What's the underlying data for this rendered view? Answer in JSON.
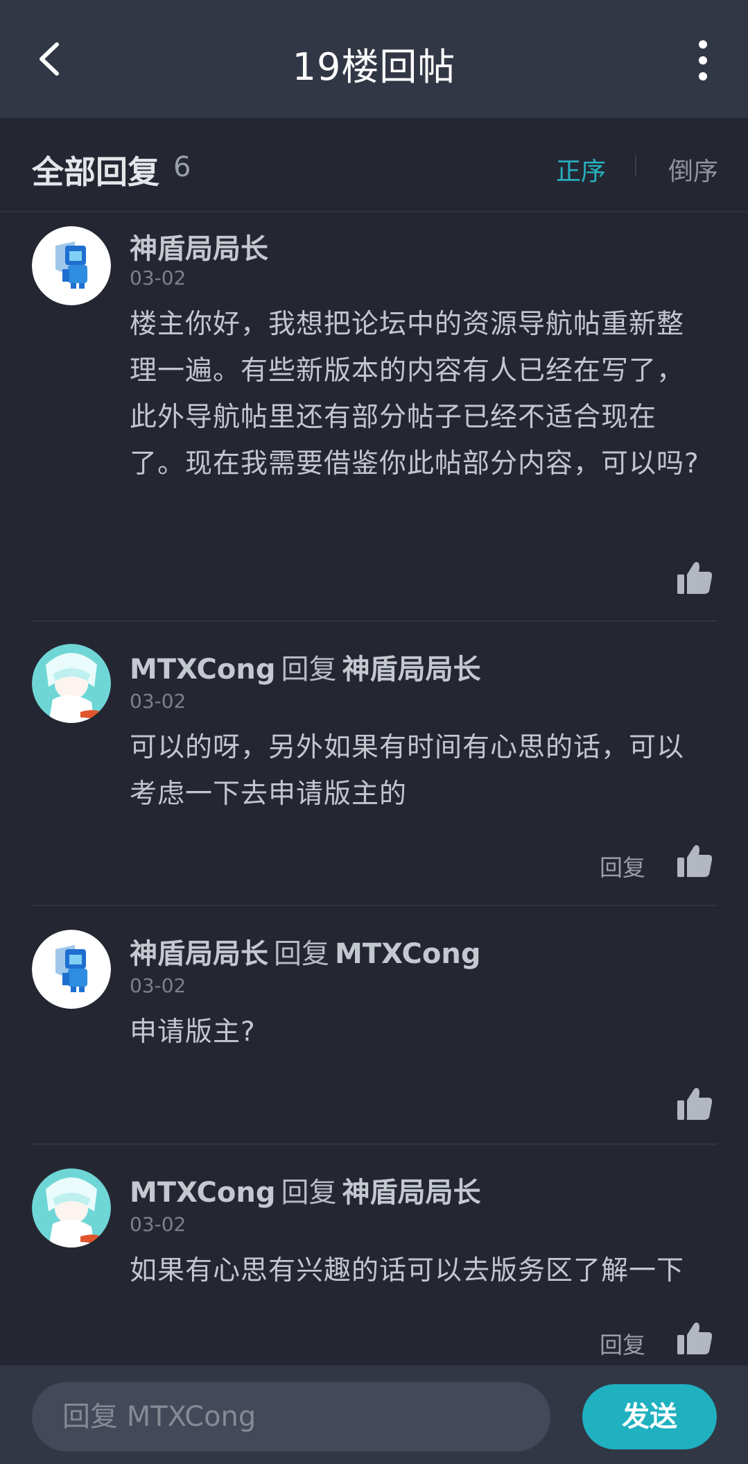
{
  "header": {
    "title": "19楼回帖",
    "back_icon": "chevron-left-icon",
    "more_icon": "more-vertical-icon"
  },
  "sort": {
    "label": "全部回复",
    "count": "6",
    "asc_label": "正序",
    "desc_label": "倒序",
    "active_color": "#27b2c2"
  },
  "replies": [
    {
      "author": "神盾局局长",
      "verb": "",
      "target": "",
      "date": "03-02",
      "content": "楼主你好，我想把论坛中的资源导航帖重新整理一遍。有些新版本的内容有人已经在写了，此外导航帖里还有部分帖子已经不适合现在了。现在我需要借鉴你此帖部分内容，可以吗?",
      "reply_label": ""
    },
    {
      "author": "MTXCong",
      "verb": "回复",
      "target": "神盾局局长",
      "date": "03-02",
      "content": "可以的呀，另外如果有时间有心思的话，可以考虑一下去申请版主的",
      "reply_label": "回复"
    },
    {
      "author": "神盾局局长",
      "verb": "回复",
      "target": "MTXCong",
      "date": "03-02",
      "content": "申请版主?",
      "reply_label": ""
    },
    {
      "author": "MTXCong",
      "verb": "回复",
      "target": "神盾局局长",
      "date": "03-02",
      "content": "如果有心思有兴趣的话可以去版务区了解一下",
      "reply_label": "回复"
    }
  ],
  "composer": {
    "placeholder": "回复 MTXCong",
    "send_label": "发送",
    "accent": "#1fb1c0"
  }
}
